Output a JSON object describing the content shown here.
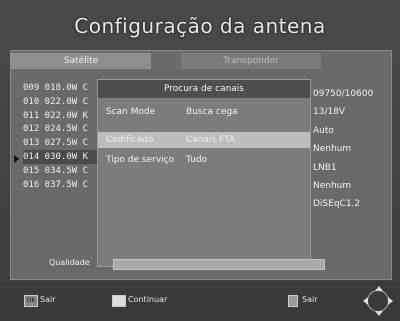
{
  "header": {
    "title": "Configuração da antena"
  },
  "tabs": {
    "satellite": "Satélite",
    "transponder": "Transponder"
  },
  "satellites": [
    "009 018.0W C",
    "010 022.0W C",
    "011 022.0W K",
    "012 024.5W C",
    "013 027.5W C",
    "014 030.0W K",
    "015 034.5W C",
    "016 037.5W C"
  ],
  "selected_satellite_index": 5,
  "right_column": [
    "09750/10600",
    "13/18V",
    "Auto",
    "Nenhum",
    "LNB1",
    "Nenhum",
    "DiSEqC1.2"
  ],
  "dialog": {
    "title": "Procura de canais",
    "rows": [
      {
        "label": "Scan Mode",
        "value": "Busca cega"
      },
      {
        "label": "Codificado",
        "value": "Canais FTA"
      },
      {
        "label": "Tipo de serviço",
        "value": "Tudo"
      }
    ],
    "highlighted_row_index": 1
  },
  "bottom": {
    "label": "Qualidade"
  },
  "footer": [
    {
      "key": "OK",
      "label": "Sair"
    },
    {
      "key": "",
      "label": "Continuar"
    },
    {
      "key": "",
      "label": "Sair"
    }
  ]
}
